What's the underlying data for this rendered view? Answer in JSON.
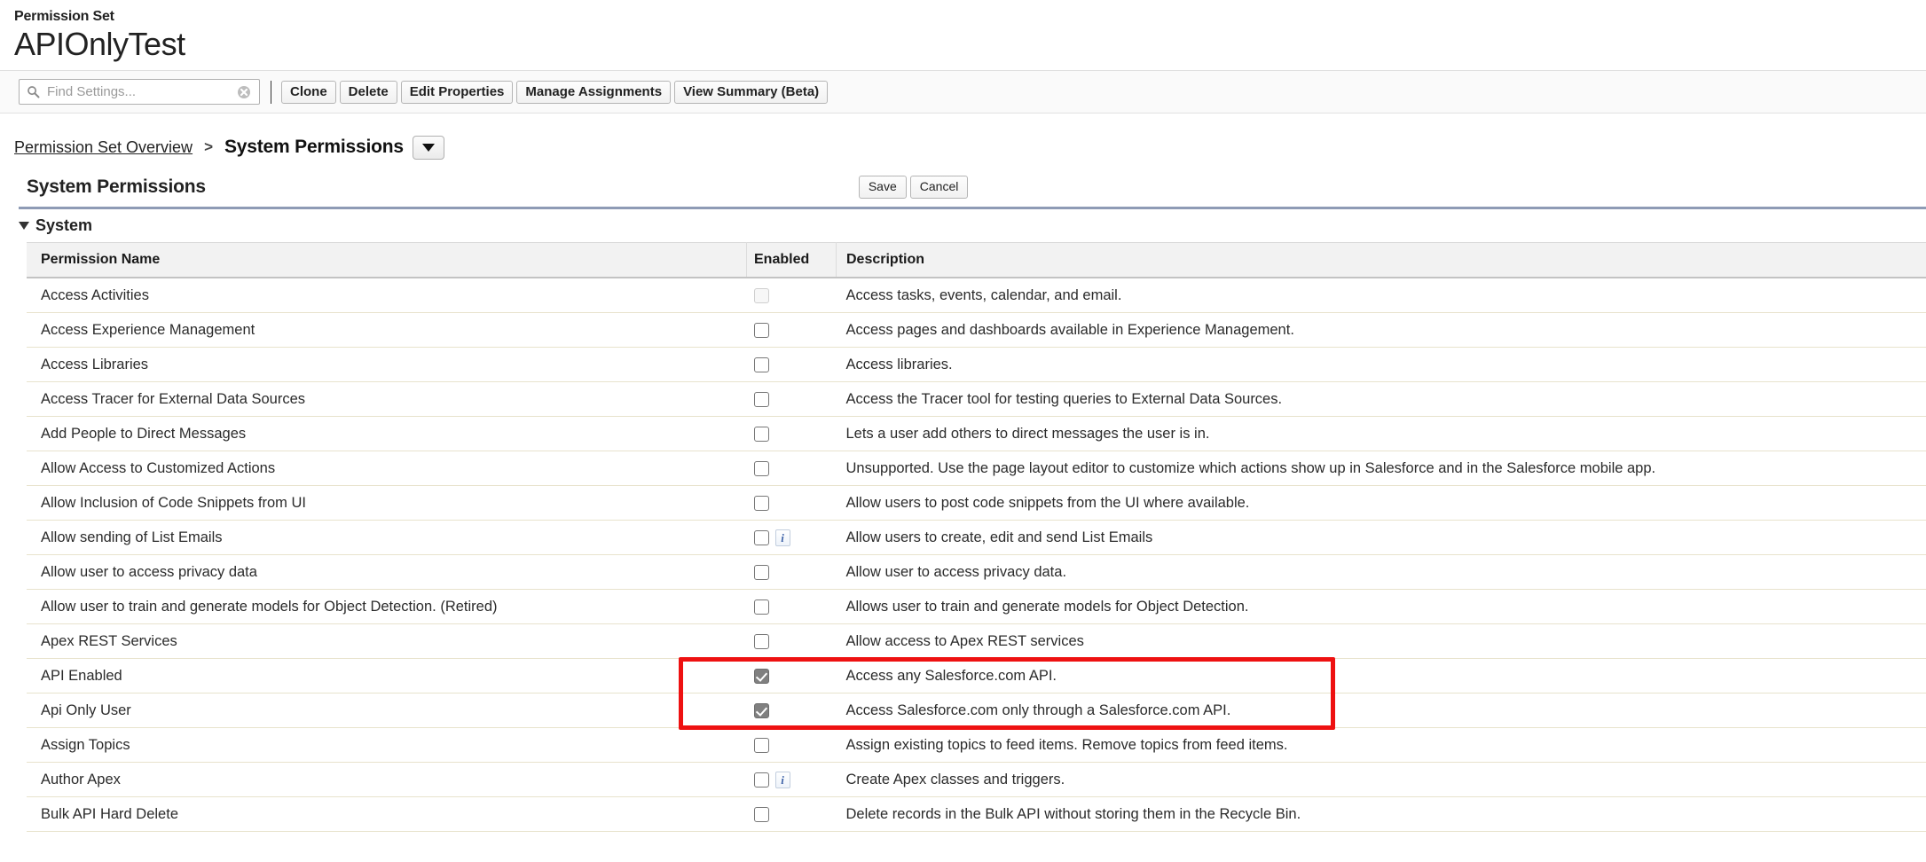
{
  "header": {
    "eyebrow": "Permission Set",
    "title": "APIOnlyTest"
  },
  "toolbar": {
    "search_placeholder": "Find Settings...",
    "search_value": "",
    "search_icon": "search-icon",
    "clear_icon": "clear-icon",
    "buttons": [
      {
        "label": "Clone"
      },
      {
        "label": "Delete"
      },
      {
        "label": "Edit Properties"
      },
      {
        "label": "Manage Assignments"
      },
      {
        "label": "View Summary (Beta)"
      }
    ]
  },
  "breadcrumb": {
    "link": "Permission Set Overview",
    "separator": ">",
    "current": "System Permissions",
    "menu_icon": "chevron-down-icon"
  },
  "section": {
    "title": "System Permissions",
    "save_label": "Save",
    "cancel_label": "Cancel",
    "group_label": "System",
    "group_caret_icon": "triangle-down-icon"
  },
  "table": {
    "columns": [
      "Permission Name",
      "Enabled",
      "Description"
    ],
    "rows": [
      {
        "name": "Access Activities",
        "checked": false,
        "disabled": true,
        "info": false,
        "description": "Access tasks, events, calendar, and email."
      },
      {
        "name": "Access Experience Management",
        "checked": false,
        "disabled": false,
        "info": false,
        "description": "Access pages and dashboards available in Experience Management."
      },
      {
        "name": "Access Libraries",
        "checked": false,
        "disabled": false,
        "info": false,
        "description": "Access libraries."
      },
      {
        "name": "Access Tracer for External Data Sources",
        "checked": false,
        "disabled": false,
        "info": false,
        "description": "Access the Tracer tool for testing queries to External Data Sources."
      },
      {
        "name": "Add People to Direct Messages",
        "checked": false,
        "disabled": false,
        "info": false,
        "description": "Lets a user add others to direct messages the user is in."
      },
      {
        "name": "Allow Access to Customized Actions",
        "checked": false,
        "disabled": false,
        "info": false,
        "description": "Unsupported. Use the page layout editor to customize which actions show up in Salesforce and in the Salesforce mobile app."
      },
      {
        "name": "Allow Inclusion of Code Snippets from UI",
        "checked": false,
        "disabled": false,
        "info": false,
        "description": "Allow users to post code snippets from the UI where available."
      },
      {
        "name": "Allow sending of List Emails",
        "checked": false,
        "disabled": false,
        "info": true,
        "description": "Allow users to create, edit and send List Emails"
      },
      {
        "name": "Allow user to access privacy data",
        "checked": false,
        "disabled": false,
        "info": false,
        "description": "Allow user to access privacy data."
      },
      {
        "name": "Allow user to train and generate models for Object Detection. (Retired)",
        "checked": false,
        "disabled": false,
        "info": false,
        "description": "Allows user to train and generate models for Object Detection."
      },
      {
        "name": "Apex REST Services",
        "checked": false,
        "disabled": false,
        "info": false,
        "description": "Allow access to Apex REST services"
      },
      {
        "name": "API Enabled",
        "checked": true,
        "disabled": false,
        "info": false,
        "description": "Access any Salesforce.com API."
      },
      {
        "name": "Api Only User",
        "checked": true,
        "disabled": false,
        "info": false,
        "description": "Access Salesforce.com only through a Salesforce.com API."
      },
      {
        "name": "Assign Topics",
        "checked": false,
        "disabled": false,
        "info": false,
        "description": "Assign existing topics to feed items. Remove topics from feed items."
      },
      {
        "name": "Author Apex",
        "checked": false,
        "disabled": false,
        "info": true,
        "description": "Create Apex classes and triggers."
      },
      {
        "name": "Bulk API Hard Delete",
        "checked": false,
        "disabled": false,
        "info": false,
        "description": "Delete records in the Bulk API without storing them in the Recycle Bin."
      }
    ]
  },
  "annotation": {
    "highlight_color": "#ee1111",
    "highlight_rows": [
      "API Enabled",
      "Api Only User"
    ]
  }
}
